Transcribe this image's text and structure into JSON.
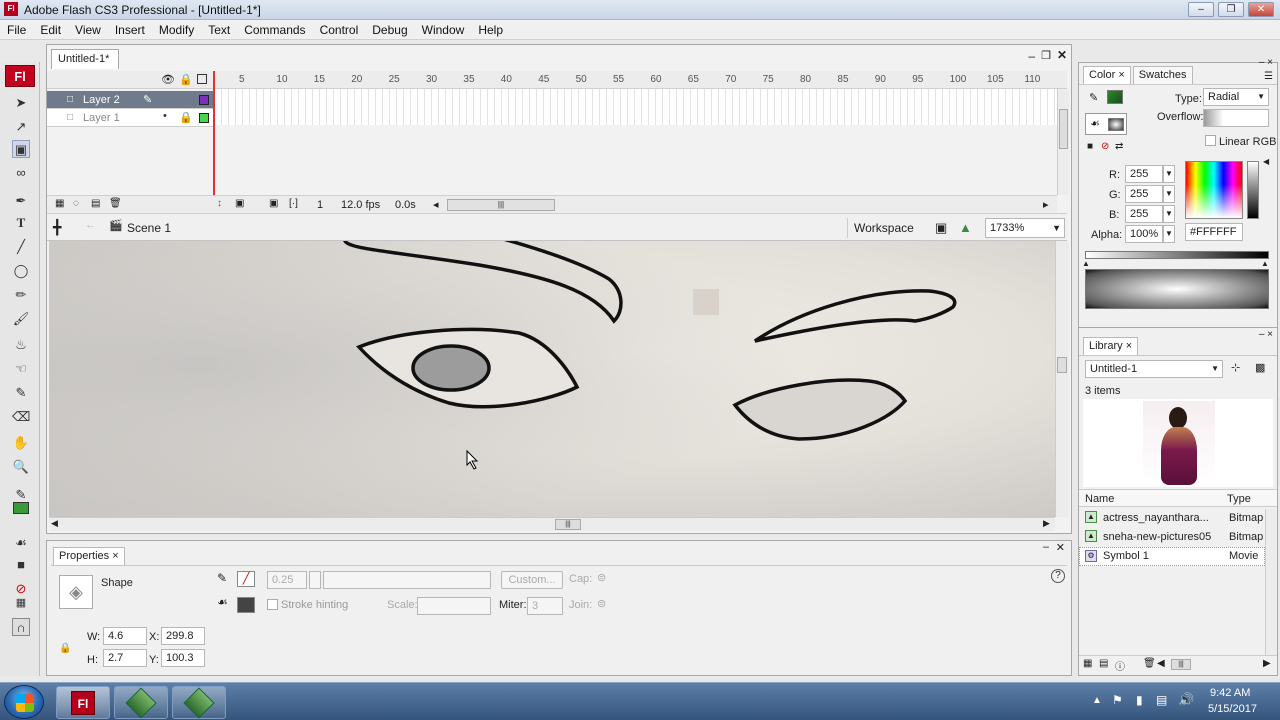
{
  "window": {
    "title": "Adobe Flash CS3 Professional - [Untitled-1*]",
    "app_logo": "Fl"
  },
  "menu": [
    "File",
    "Edit",
    "View",
    "Insert",
    "Modify",
    "Text",
    "Commands",
    "Control",
    "Debug",
    "Window",
    "Help"
  ],
  "document": {
    "tab": "Untitled-1*",
    "frame_numbers": [
      "5",
      "10",
      "15",
      "20",
      "25",
      "30",
      "35",
      "40",
      "45",
      "50",
      "55",
      "60",
      "65",
      "70",
      "75",
      "80",
      "85",
      "90",
      "95",
      "100",
      "105",
      "110"
    ],
    "layers": [
      {
        "name": "Layer 2",
        "color": "#7b2fbf",
        "active": true
      },
      {
        "name": "Layer 1",
        "color": "#49d64a",
        "active": false
      }
    ],
    "timeline_footer": {
      "frame": "1",
      "fps": "12.0 fps",
      "time": "0.0s"
    },
    "scene": "Scene 1",
    "workspace": "Workspace",
    "zoom": "1733%"
  },
  "properties": {
    "tab": "Properties",
    "type": "Shape",
    "stroke_size": "0.25",
    "custom_btn": "Custom...",
    "cap_label": "Cap:",
    "stroke_hinting": "Stroke hinting",
    "scale_label": "Scale:",
    "miter_label": "Miter:",
    "miter_value": "3",
    "join_label": "Join:",
    "w_label": "W:",
    "w": "4.6",
    "h_label": "H:",
    "h": "2.7",
    "x_label": "X:",
    "x": "299.8",
    "y_label": "Y:",
    "y": "100.3"
  },
  "color_panel": {
    "tabs": [
      "Color",
      "Swatches"
    ],
    "type_label": "Type:",
    "type_value": "Radial",
    "overflow_label": "Overflow:",
    "linear_rgb": "Linear RGB",
    "r_label": "R:",
    "r": "255",
    "g_label": "G:",
    "g": "255",
    "b_label": "B:",
    "b": "255",
    "alpha_label": "Alpha:",
    "alpha": "100%",
    "hex": "#FFFFFF"
  },
  "library": {
    "tab": "Library",
    "doc": "Untitled-1",
    "count": "3 items",
    "col_name": "Name",
    "col_type": "Type",
    "items": [
      {
        "name": "actress_nayanthara...",
        "type": "Bitmap"
      },
      {
        "name": "sneha-new-pictures05",
        "type": "Bitmap"
      },
      {
        "name": "Symbol 1",
        "type": "Movie"
      }
    ]
  },
  "taskbar": {
    "time": "9:42 AM",
    "date": "5/15/2017"
  },
  "colors": {
    "flash_red": "#c4001f",
    "timeline_playhead": "#e53030"
  }
}
